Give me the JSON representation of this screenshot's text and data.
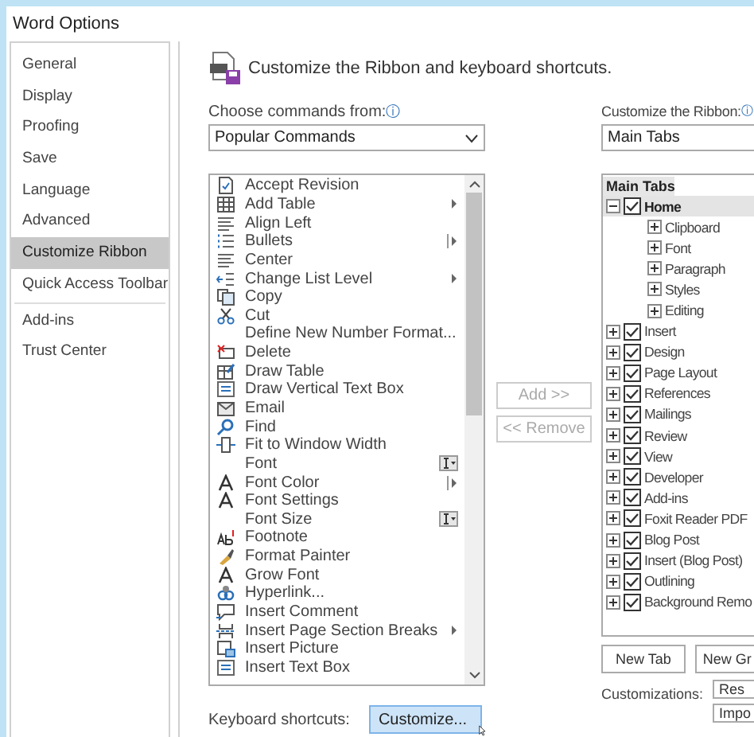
{
  "window": {
    "title": "Word Options"
  },
  "sidebar": {
    "sections": [
      {
        "items": [
          {
            "label": "General",
            "selected": false
          },
          {
            "label": "Display",
            "selected": false
          },
          {
            "label": "Proofing",
            "selected": false
          },
          {
            "label": "Save",
            "selected": false
          },
          {
            "label": "Language",
            "selected": false
          },
          {
            "label": "Advanced",
            "selected": false
          },
          {
            "label": "Customize Ribbon",
            "selected": true
          },
          {
            "label": "Quick Access Toolbar",
            "selected": false
          }
        ]
      },
      {
        "items": [
          {
            "label": "Add-ins",
            "selected": false
          },
          {
            "label": "Trust Center",
            "selected": false
          }
        ]
      }
    ]
  },
  "header": {
    "title": "Customize the Ribbon and keyboard shortcuts."
  },
  "commands": {
    "label": "Choose commands from:",
    "info": "ⓘ",
    "dropdown": {
      "value": "Popular Commands"
    },
    "items": [
      {
        "label": "Accept Revision",
        "kind": "plain"
      },
      {
        "label": "Add Table",
        "kind": "submenu"
      },
      {
        "label": "Align Left",
        "kind": "plain"
      },
      {
        "label": "Bullets",
        "kind": "split"
      },
      {
        "label": "Center",
        "kind": "plain"
      },
      {
        "label": "Change List Level",
        "kind": "submenu"
      },
      {
        "label": "Copy",
        "kind": "plain"
      },
      {
        "label": "Cut",
        "kind": "plain"
      },
      {
        "label": "Define New Number Format...",
        "kind": "plain"
      },
      {
        "label": "Delete",
        "kind": "plain"
      },
      {
        "label": "Draw Table",
        "kind": "plain"
      },
      {
        "label": "Draw Vertical Text Box",
        "kind": "plain"
      },
      {
        "label": "Email",
        "kind": "plain"
      },
      {
        "label": "Find",
        "kind": "plain"
      },
      {
        "label": "Fit to Window Width",
        "kind": "plain"
      },
      {
        "label": "Font",
        "kind": "combo"
      },
      {
        "label": "Font Color",
        "kind": "split"
      },
      {
        "label": "Font Settings",
        "kind": "plain"
      },
      {
        "label": "Font Size",
        "kind": "combo"
      },
      {
        "label": "Footnote",
        "kind": "plain"
      },
      {
        "label": "Format Painter",
        "kind": "plain"
      },
      {
        "label": "Grow Font",
        "kind": "plain"
      },
      {
        "label": "Hyperlink...",
        "kind": "plain"
      },
      {
        "label": "Insert Comment",
        "kind": "plain"
      },
      {
        "label": "Insert Page  Section Breaks",
        "kind": "submenu"
      },
      {
        "label": "Insert Picture",
        "kind": "plain"
      },
      {
        "label": "Insert Text Box",
        "kind": "plain"
      }
    ]
  },
  "transfer": {
    "add": {
      "label": "Add >>",
      "disabled": true
    },
    "remove": {
      "label": "<< Remove",
      "disabled": true
    }
  },
  "ribbon": {
    "label": "Customize the Ribbon:",
    "info": "ⓘ",
    "dropdown": {
      "value": "Main Tabs"
    },
    "tree_header": "Main Tabs",
    "tabs": [
      {
        "label": "Home",
        "checked": true,
        "expanded": true,
        "selected": true,
        "children": [
          {
            "label": "Clipboard"
          },
          {
            "label": "Font"
          },
          {
            "label": "Paragraph"
          },
          {
            "label": "Styles"
          },
          {
            "label": "Editing"
          }
        ]
      },
      {
        "label": "Insert",
        "checked": true,
        "expanded": false,
        "selected": false
      },
      {
        "label": "Design",
        "checked": true,
        "expanded": false,
        "selected": false
      },
      {
        "label": "Page Layout",
        "checked": true,
        "expanded": false,
        "selected": false
      },
      {
        "label": "References",
        "checked": true,
        "expanded": false,
        "selected": false
      },
      {
        "label": "Mailings",
        "checked": true,
        "expanded": false,
        "selected": false
      },
      {
        "label": "Review",
        "checked": true,
        "expanded": false,
        "selected": false
      },
      {
        "label": "View",
        "checked": true,
        "expanded": false,
        "selected": false
      },
      {
        "label": "Developer",
        "checked": true,
        "expanded": false,
        "selected": false
      },
      {
        "label": "Add-ins",
        "checked": true,
        "expanded": false,
        "selected": false
      },
      {
        "label": "Foxit Reader PDF",
        "checked": true,
        "expanded": false,
        "selected": false
      },
      {
        "label": "Blog Post",
        "checked": true,
        "expanded": false,
        "selected": false
      },
      {
        "label": "Insert (Blog Post)",
        "checked": true,
        "expanded": false,
        "selected": false
      },
      {
        "label": "Outlining",
        "checked": true,
        "expanded": false,
        "selected": false
      },
      {
        "label": "Background Remo",
        "checked": true,
        "expanded": false,
        "selected": false
      }
    ],
    "new_tab": "New Tab",
    "new_group": "New Gr",
    "customizations_label": "Customizations:",
    "reset": "Res",
    "import": "Impo"
  },
  "shortcuts": {
    "label": "Keyboard shortcuts:",
    "button": "Customize..."
  }
}
